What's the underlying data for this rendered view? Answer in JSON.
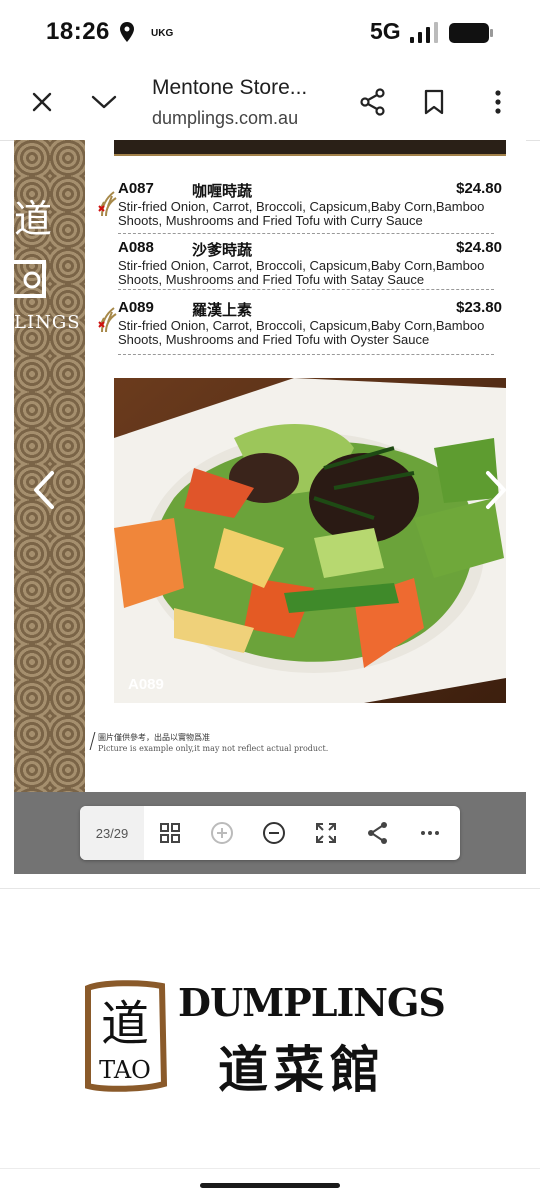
{
  "status_bar": {
    "time": "18:26",
    "carrier": "UKG",
    "network": "5G",
    "icons": [
      "location-icon",
      "signal-icon",
      "battery-icon"
    ]
  },
  "browser": {
    "title": "Mentone Store...",
    "url": "dumplings.com.au",
    "icons": [
      "close-icon",
      "chevron-down-icon",
      "share-icon",
      "bookmark-icon",
      "more-vertical-icon"
    ]
  },
  "menu": {
    "items": [
      {
        "code": "A087",
        "name_cn": "咖喱時蔬",
        "price": "$24.80",
        "desc1": "Stir-fried Onion, Carrot, Broccoli, Capsicum,Baby Corn,Bamboo",
        "desc2": "Shoots, Mushrooms and Fried Tofu with Curry Sauce",
        "vegetarian": true
      },
      {
        "code": "A088",
        "name_cn": "沙爹時蔬",
        "price": "$24.80",
        "desc1": "Stir-fried Onion, Carrot, Broccoli, Capsicum,Baby Corn,Bamboo",
        "desc2": "Shoots, Mushrooms and Fried Tofu with Satay Sauce",
        "vegetarian": false
      },
      {
        "code": "A089",
        "name_cn": "羅漢上素",
        "price": "$23.80",
        "desc1": "Stir-fried Onion, Carrot, Broccoli, Capsicum,Baby Corn,Bamboo",
        "desc2": "Shoots, Mushrooms and Fried Tofu with Oyster Sauce",
        "vegetarian": true
      }
    ],
    "photo_label": "A089",
    "note_cn": "圖片僅供參考，出品以實物爲准",
    "note_en": "Picture is example only,it may not reflect actual product.",
    "side_word": "LINGS"
  },
  "pdf_toolbar": {
    "page_count": "23/29",
    "icons": [
      "grid-icon",
      "zoom-in-icon",
      "zoom-out-icon",
      "fullscreen-icon",
      "share-icon",
      "more-horizontal-icon"
    ]
  },
  "logo": {
    "brand": "DUMPLINGS",
    "brand_cn": "道菜館",
    "emblem_text": "TAO",
    "emblem_char": "道"
  },
  "colors": {
    "side_pattern": "#8c7555",
    "pdf_gray": "#737373",
    "veg_mark": "#d01010"
  }
}
